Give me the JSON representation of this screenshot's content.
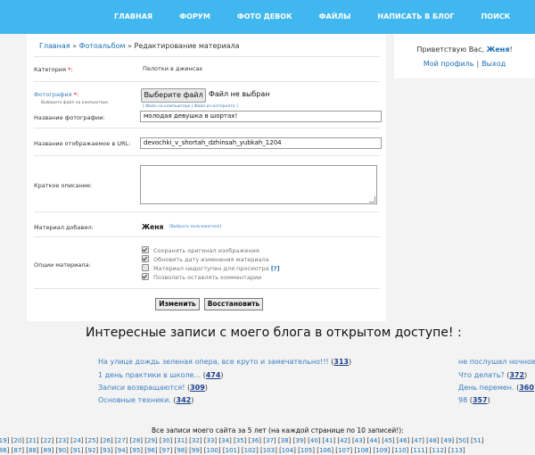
{
  "nav": {
    "items": [
      "ГЛАВНАЯ",
      "ФОРУМ",
      "ФОТО ДЕВОК",
      "ФАЙЛЫ",
      "НАПИСАТЬ В БЛОГ",
      "ПОИСК"
    ]
  },
  "breadcrumb": {
    "home": "Главная",
    "album": "Фотоальбом",
    "current": "Редактирование материала",
    "separator": "»"
  },
  "form": {
    "category_label": "Категория",
    "required_mark": "*:",
    "category_value": "Пелотки в джинсах",
    "photo_label": "Фотография",
    "photo_hint": "Выберите файл на компьютере.",
    "file_button": "Выберите файл",
    "file_status": "Файл не выбран",
    "file_links": "[ Файл на компьютере | Файл из интернета ]",
    "photo_name_label": "Название фотографии:",
    "photo_name_value": "молодая девушка в шортах!",
    "url_label": "Название отображаемое в URL:",
    "url_value": "devochki_v_shortah_dzhinsah_yubkah_1204",
    "desc_label": "Краткое описание:",
    "added_by_label": "Материал добавил:",
    "added_by_value": "Женя",
    "choose_user": "[Выбрать пользователя]",
    "options_label": "Опции материала:",
    "options": [
      {
        "label": "Сохранять оригинал изображения",
        "checked": true
      },
      {
        "label": "Обновить дату изменения материала",
        "checked": true
      },
      {
        "label": "Материал недоступен для просмотра",
        "checked": false,
        "help": "[?]"
      },
      {
        "label": "Позволить оставлять комментарии",
        "checked": true
      }
    ],
    "submit": "Изменить",
    "reset": "Восстановить"
  },
  "user_panel": {
    "greeting": "Приветствую Вас,",
    "user": "Женя",
    "profile": "Мой профиль",
    "logout": "Выход",
    "separator": "|"
  },
  "heading": "Интересные записи с моего блога в открытом доступе! :",
  "blog_links_left": [
    {
      "text": "На улице дождь зеленая опера, все круто и замечательно!!!",
      "count": "313"
    },
    {
      "text": "1 день практики в школе...",
      "count": "474"
    },
    {
      "text": "Записи возвращаются!",
      "count": "309"
    },
    {
      "text": "Основные техники.",
      "count": "342"
    }
  ],
  "blog_links_right": [
    {
      "text": "не послушал ночное",
      "count": ""
    },
    {
      "text": "Что делать?",
      "count": "372"
    },
    {
      "text": "День перемен.",
      "count": "360"
    },
    {
      "text": "98",
      "count": "357"
    }
  ],
  "all_posts": "Все записи моего сайта за 5 лет (на каждой странице по 10 записей!):",
  "pages_row1": [
    "19",
    "20",
    "21",
    "22",
    "23",
    "24",
    "25",
    "26",
    "27",
    "28",
    "29",
    "30",
    "31",
    "32",
    "33",
    "34",
    "35",
    "36",
    "37",
    "38",
    "39",
    "40",
    "41",
    "42",
    "43",
    "44",
    "45",
    "46",
    "47",
    "48",
    "49",
    "50",
    "51"
  ],
  "pages_row2": [
    "86",
    "87",
    "88",
    "89",
    "90",
    "91",
    "92",
    "93",
    "94",
    "95",
    "96",
    "97",
    "98",
    "99",
    "100",
    "101",
    "102",
    "103",
    "104",
    "105",
    "106",
    "107",
    "108",
    "109",
    "110",
    "111",
    "112",
    "113"
  ],
  "colors": {
    "nav": "#40b7ee",
    "link": "#1a6fb5",
    "page_bg": "#f3f3f3"
  }
}
